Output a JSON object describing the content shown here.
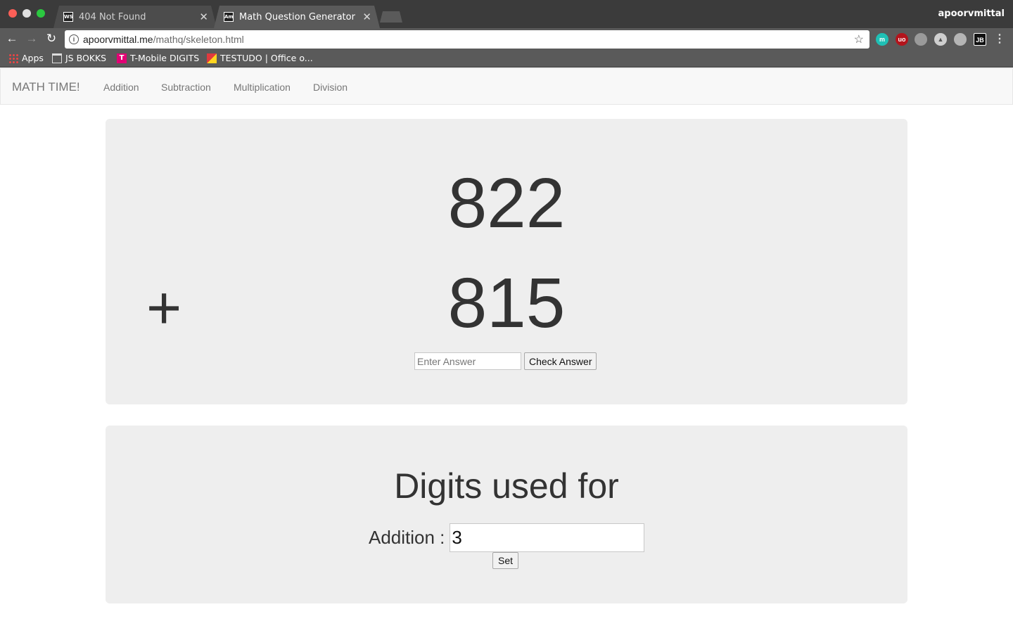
{
  "browser": {
    "tabs": [
      {
        "title": "404 Not Found",
        "favicon": "WS"
      },
      {
        "title": "Math Question Generator",
        "favicon": "Am"
      }
    ],
    "profile": "apoorvmittal",
    "url_host": "apoorvmittal.me",
    "url_path": "/mathq/skeleton.html",
    "bookmarks": [
      "Apps",
      "JS BOKKS",
      "T-Mobile DIGITS",
      "TESTUDO | Office o..."
    ],
    "extensions": {
      "m": "m",
      "ub": "uo",
      "jb": "JB"
    }
  },
  "navbar": {
    "brand": "MATH TIME!",
    "links": [
      "Addition",
      "Subtraction",
      "Multiplication",
      "Division"
    ]
  },
  "question": {
    "number1": "822",
    "number2": "815",
    "operator": "+",
    "answer_placeholder": "Enter Answer",
    "check_label": "Check Answer"
  },
  "settings": {
    "title": "Digits used for",
    "label": "Addition :",
    "value": "3",
    "set_label": "Set"
  }
}
